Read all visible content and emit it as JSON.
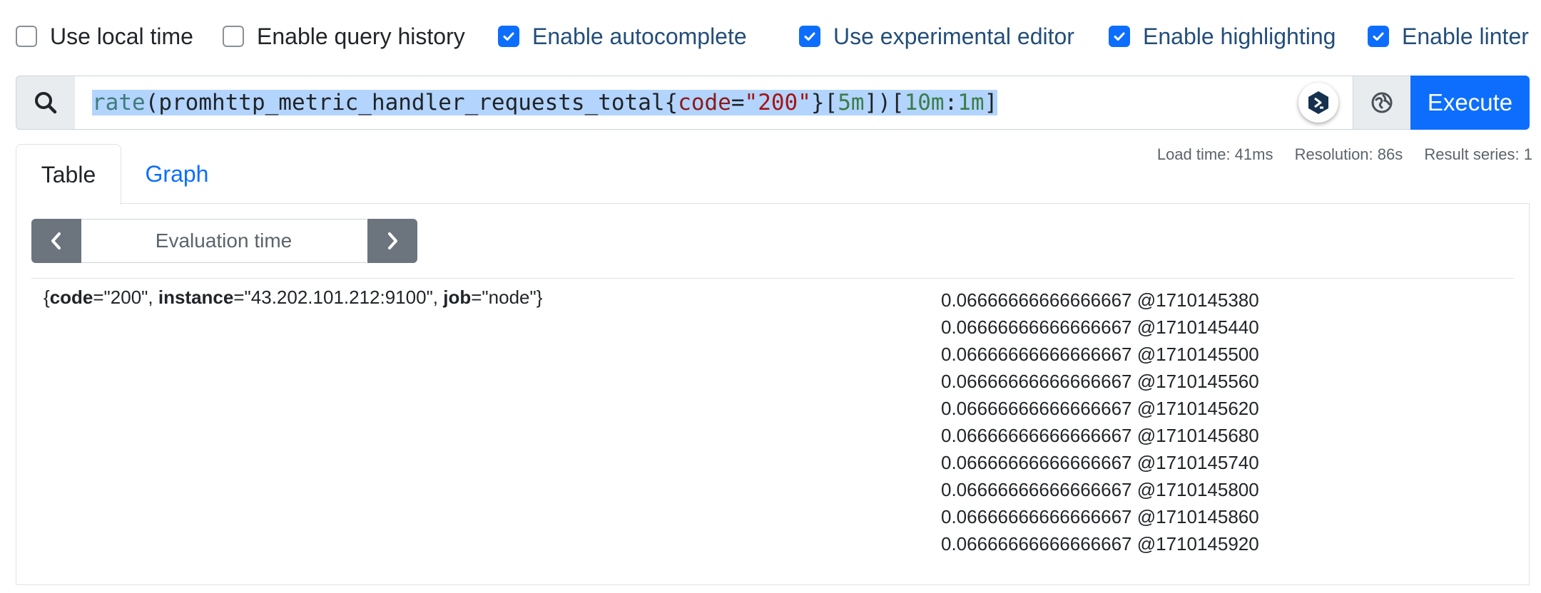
{
  "options": [
    {
      "label": "Use local time",
      "checked": false
    },
    {
      "label": "Enable query history",
      "checked": false
    },
    {
      "label": "Enable autocomplete",
      "checked": true
    },
    {
      "label": "Use experimental editor",
      "checked": true
    },
    {
      "label": "Enable highlighting",
      "checked": true
    },
    {
      "label": "Enable linter",
      "checked": true
    }
  ],
  "query": {
    "fn": "rate",
    "open_paren": "(",
    "metric": "promhttp_metric_handler_requests_total",
    "open_brace": "{",
    "label_name": "code",
    "equals": "=",
    "label_value": "\"200\"",
    "close_brace": "}",
    "range_open": "[",
    "range": "5m",
    "range_close": "]",
    "close_paren": ")",
    "subquery_open": "[",
    "subquery_range": "10m",
    "subquery_colon": ":",
    "subquery_step": "1m",
    "subquery_close": "]"
  },
  "execute_label": "Execute",
  "tabs": {
    "table": "Table",
    "graph": "Graph"
  },
  "stats": {
    "load_time": "Load time: 41ms",
    "resolution": "Resolution: 86s",
    "result_series": "Result series: 1"
  },
  "eval_time_placeholder": "Evaluation time",
  "result": {
    "series_labels": {
      "open": "{",
      "code_key": "code",
      "code_val": "=\"200\", ",
      "instance_key": "instance",
      "instance_val": "=\"43.202.101.212:9100\", ",
      "job_key": "job",
      "job_val": "=\"node\"",
      "close": "}"
    },
    "values": [
      "0.06666666666666667 @1710145380",
      "0.06666666666666667 @1710145440",
      "0.06666666666666667 @1710145500",
      "0.06666666666666667 @1710145560",
      "0.06666666666666667 @1710145620",
      "0.06666666666666667 @1710145680",
      "0.06666666666666667 @1710145740",
      "0.06666666666666667 @1710145800",
      "0.06666666666666667 @1710145860",
      "0.06666666666666667 @1710145920"
    ]
  },
  "colors": {
    "accent": "#0d6efd",
    "button_secondary": "#6c757d"
  },
  "icons": {
    "search": "search-icon",
    "ai": "ai-assistant-icon",
    "metrics": "metrics-explorer-icon",
    "prev": "chevron-left-icon",
    "next": "chevron-right-icon"
  }
}
